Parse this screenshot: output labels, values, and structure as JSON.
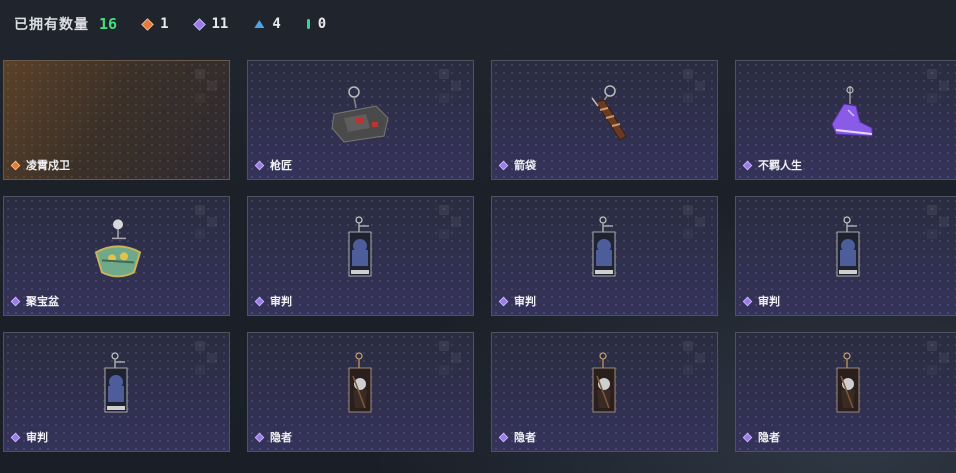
{
  "header": {
    "title": "已拥有数量",
    "total": "16",
    "stats": [
      {
        "icon": "orange-diamond-icon",
        "color": "#e07a3d",
        "count": "1"
      },
      {
        "icon": "purple-diamond-icon",
        "color": "#9a7be6",
        "count": "11"
      },
      {
        "icon": "blue-triangle-icon",
        "color": "#4fa3e0",
        "count": "4"
      },
      {
        "icon": "teal-bar-icon",
        "color": "#3ccfa0",
        "count": "0"
      }
    ]
  },
  "cards": [
    {
      "label": "凌霄戍卫",
      "rarity": "orange",
      "item": "none"
    },
    {
      "label": "枪匠",
      "rarity": "purple",
      "item": "crate-keychain"
    },
    {
      "label": "箭袋",
      "rarity": "purple",
      "item": "quiver-keychain"
    },
    {
      "label": "不羁人生",
      "rarity": "purple",
      "item": "sneaker-keychain"
    },
    {
      "label": "聚宝盆",
      "rarity": "purple",
      "item": "treasure-bowl-keychain"
    },
    {
      "label": "审判",
      "rarity": "purple",
      "item": "judgement-card-keychain"
    },
    {
      "label": "审判",
      "rarity": "purple",
      "item": "judgement-card-keychain"
    },
    {
      "label": "审判",
      "rarity": "purple",
      "item": "judgement-card-keychain"
    },
    {
      "label": "审判",
      "rarity": "purple",
      "item": "judgement-card-keychain"
    },
    {
      "label": "隐者",
      "rarity": "purple",
      "item": "hermit-card-keychain"
    },
    {
      "label": "隐者",
      "rarity": "purple",
      "item": "hermit-card-keychain"
    },
    {
      "label": "隐者",
      "rarity": "purple",
      "item": "hermit-card-keychain"
    }
  ]
}
